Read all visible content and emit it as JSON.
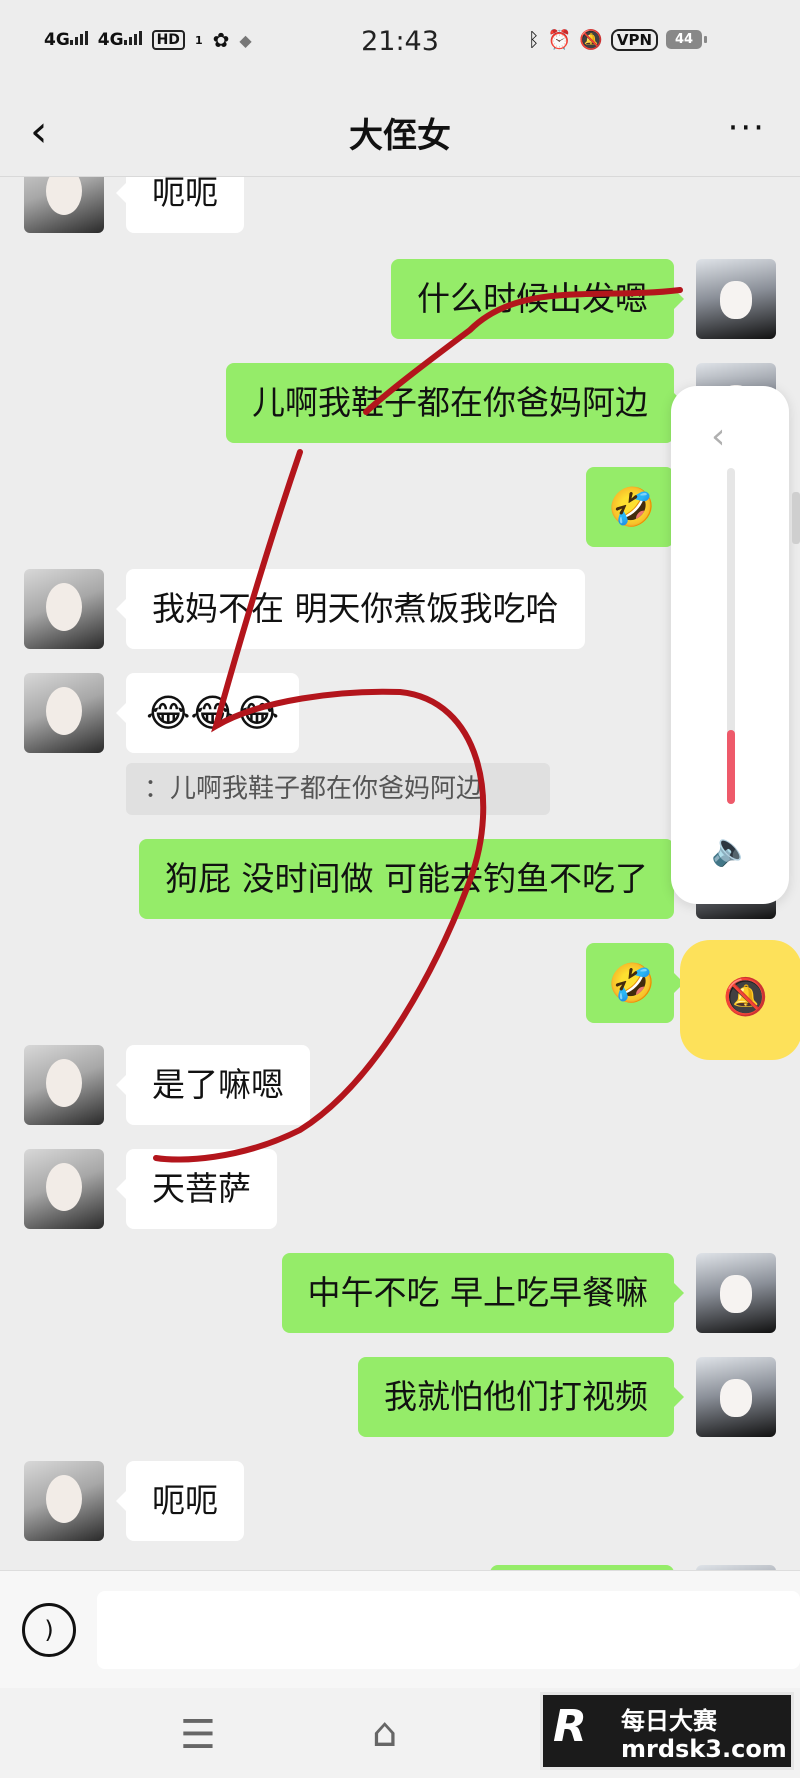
{
  "status_bar": {
    "network1": "4G",
    "network2": "4G",
    "hd": "HD",
    "sim": "1",
    "time": "21:43",
    "vpn": "VPN",
    "battery": "44"
  },
  "header": {
    "title": "大侄女"
  },
  "messages": [
    {
      "side": "in",
      "text": "呃呃"
    },
    {
      "side": "out",
      "text": "什么时候出发嗯"
    },
    {
      "side": "out",
      "text": "儿啊我鞋子都在你爸妈阿边"
    },
    {
      "side": "out",
      "text": "🤣"
    },
    {
      "side": "in",
      "text": "我妈不在   明天你煮饭我吃哈"
    },
    {
      "side": "in",
      "text": "😂😂😂"
    },
    {
      "side": "quote",
      "text": "：儿啊我鞋子都在你爸妈阿边"
    },
    {
      "side": "out",
      "text": "狗屁 没时间做 可能去钓鱼不吃了"
    },
    {
      "side": "out",
      "text": "🤣"
    },
    {
      "side": "in",
      "text": "是了嘛嗯"
    },
    {
      "side": "in",
      "text": "天菩萨"
    },
    {
      "side": "out",
      "text": "中午不吃 早上吃早餐嘛"
    },
    {
      "side": "out",
      "text": "我就怕他们打视频"
    },
    {
      "side": "in",
      "text": "呃呃"
    }
  ],
  "volume_panel": {
    "level_fraction": 0.22
  },
  "input_bar": {
    "value": ""
  },
  "watermark": {
    "logo": "R",
    "name": "每日大赛",
    "url": "mrdsk3.com"
  },
  "colors": {
    "outgoing_bubble": "#95ec69",
    "incoming_bubble": "#ffffff",
    "annotation_stroke": "#b3151c",
    "mute_button": "#fde15a",
    "volume_fill": "#ee5a6a"
  }
}
